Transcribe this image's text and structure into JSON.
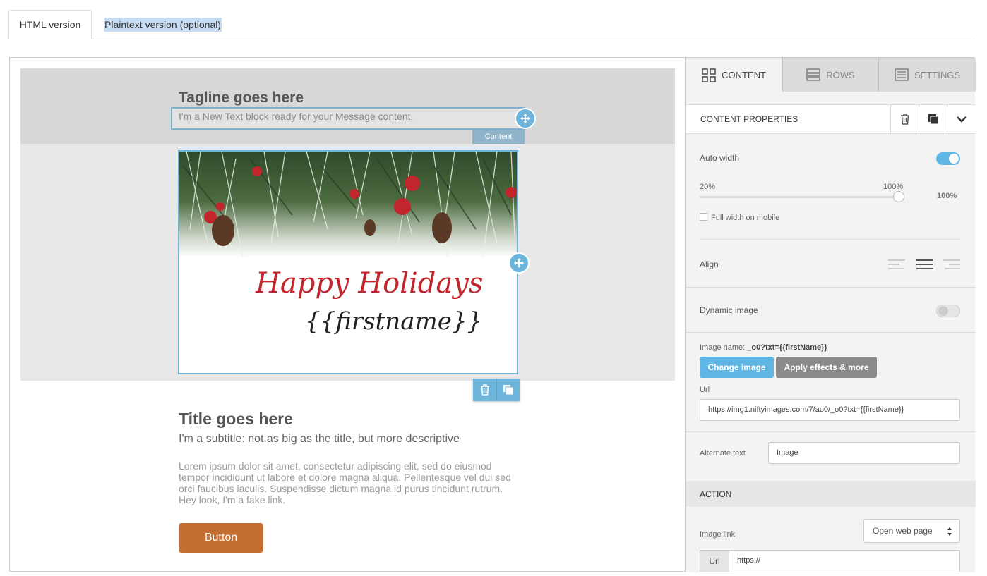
{
  "top_tabs": {
    "html_label": "HTML version",
    "plaintext_label": "Plaintext version (optional)"
  },
  "canvas": {
    "tagline": "Tagline goes here",
    "text_block": "I'm a New Text block ready for your Message content.",
    "content_tag": "Content",
    "image_text_1": "Happy Holidays",
    "image_text_2": "{{firstname}}",
    "title": "Title goes here",
    "subtitle": "I'm a subtitle: not as big as the title, but more descriptive",
    "lorem": "Lorem ipsum dolor sit amet, consectetur adipiscing elit, sed do eiusmod tempor incididunt ut labore et dolore magna aliqua. Pellentesque vel dui sed orci faucibus iaculis. Suspendisse dictum magna id purus tincidunt rutrum. Hey look, I'm a fake link.",
    "button": "Button"
  },
  "panel": {
    "tabs": [
      {
        "label": "CONTENT",
        "icon": "grid-icon"
      },
      {
        "label": "ROWS",
        "icon": "rows-icon"
      },
      {
        "label": "SETTINGS",
        "icon": "settings-doc-icon"
      }
    ],
    "content_properties": "CONTENT PROPERTIES",
    "auto_width": "Auto width",
    "slider_min": "20%",
    "slider_max": "100%",
    "width_value": "100%",
    "full_width_mobile": "Full width on mobile",
    "align": "Align",
    "dynamic_image": "Dynamic image",
    "image_name_label": "Image name:",
    "image_name_value": "_o0?txt={{firstName}}",
    "change_image": "Change image",
    "apply_effects": "Apply effects & more",
    "url_label": "Url",
    "url_value": "https://img1.niftyimages.com/7/ao0/_o0?txt={{firstName}}",
    "alt_label": "Alternate text",
    "alt_value": "Image",
    "action": "ACTION",
    "image_link": "Image link",
    "image_link_option": "Open web page",
    "link_url_prefix": "Url",
    "link_url_value": "https://"
  },
  "colors": {
    "accent": "#5fb6e4",
    "button": "#c56e34",
    "toggle_on": "#5fb6e4",
    "toggle_off": "#e0e0e0"
  }
}
